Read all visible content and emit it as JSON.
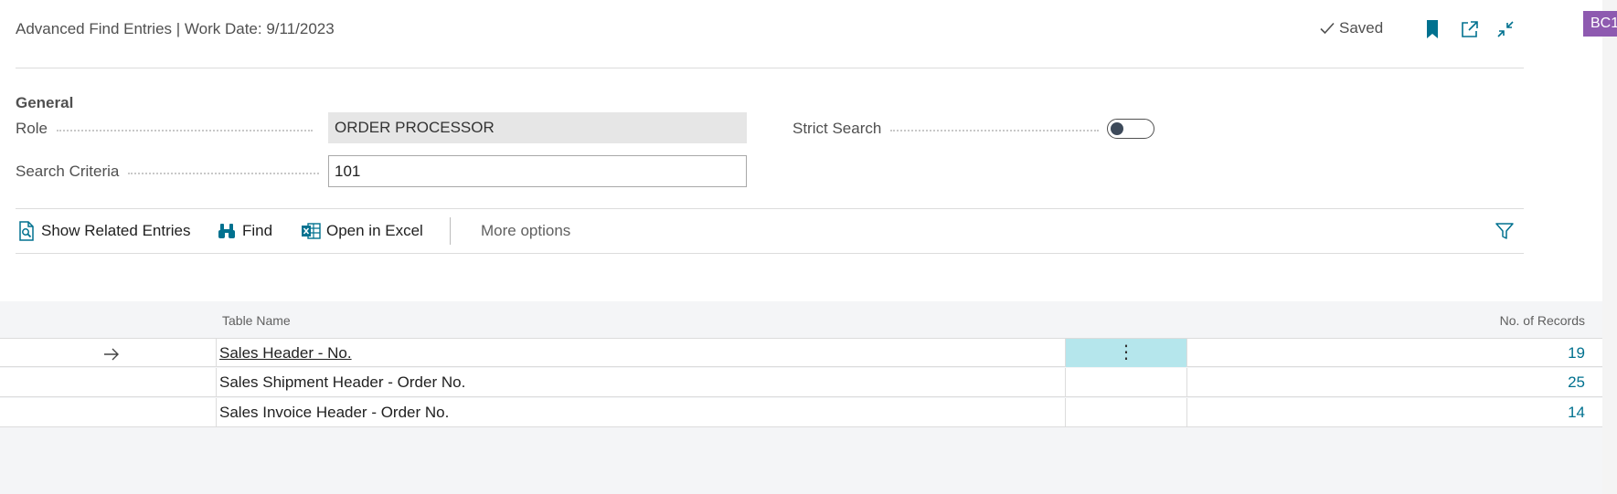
{
  "header": {
    "title": "Advanced Find Entries | Work Date: 9/11/2023",
    "saved_label": "Saved",
    "badge": "BC1"
  },
  "general": {
    "group_title": "General",
    "role_label": "Role",
    "role_value": "ORDER PROCESSOR",
    "search_label": "Search Criteria",
    "search_value": "101",
    "strict_label": "Strict Search",
    "strict_on": false
  },
  "actions": {
    "show_related": "Show Related Entries",
    "find": "Find",
    "open_excel": "Open in Excel",
    "more": "More options"
  },
  "table": {
    "col_table_name": "Table Name",
    "col_records": "No. of Records",
    "rows": [
      {
        "name": "Sales Header - No.",
        "records": "19",
        "selected": true
      },
      {
        "name": "Sales Shipment Header - Order No.",
        "records": "25",
        "selected": false
      },
      {
        "name": "Sales Invoice Header - Order No.",
        "records": "14",
        "selected": false
      }
    ]
  },
  "colors": {
    "accent": "#00718f",
    "badge": "#8e5ab0",
    "selection": "#b5e6ec"
  }
}
